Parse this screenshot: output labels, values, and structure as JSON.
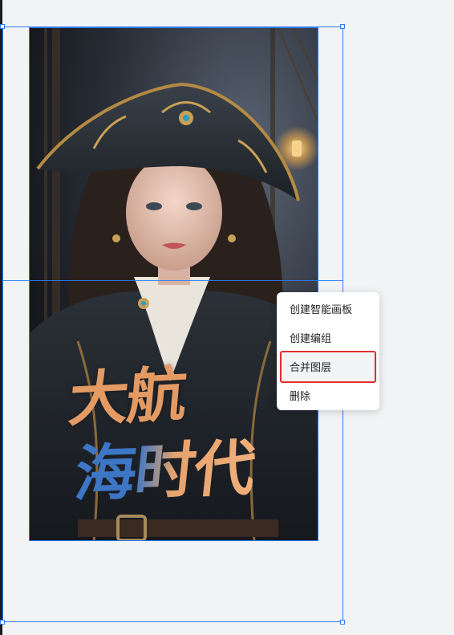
{
  "canvas": {
    "poster_title_line1": "大航",
    "poster_title_line2": "海时代"
  },
  "context_menu": {
    "items": [
      {
        "label": "创建智能画板"
      },
      {
        "label": "创建编组"
      },
      {
        "label": "合并图层"
      },
      {
        "label": "删除"
      }
    ],
    "highlighted_index": 2
  },
  "colors": {
    "selection": "#2f7cf6",
    "highlight": "#e02f2f",
    "title_orange": "#e39a63",
    "title_blue": "#3c76c4"
  }
}
